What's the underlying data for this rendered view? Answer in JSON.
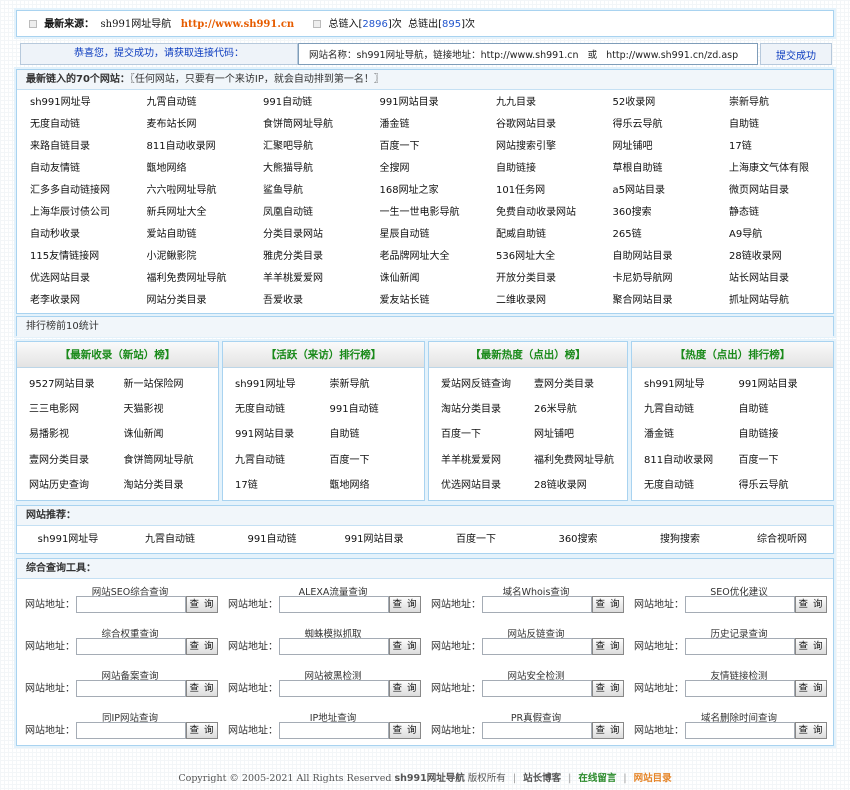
{
  "top_bar": {
    "label": "最新来源：",
    "site_name": "sh991网址导航",
    "site_url": "http://www.sh991.cn",
    "links_in_label": "总链入[",
    "links_in": "2896",
    "links_in_suffix": "]次",
    "links_out_label": "总链出[",
    "links_out": "895",
    "links_out_suffix": "]次"
  },
  "submit": {
    "congrats": "恭喜您，提交成功，请获取连接代码：",
    "code_value": "网站名称：sh991网址导航，链接地址：http://www.sh991.cn   或   http://www.sh991.cn/zd.asp",
    "button": "提交成功"
  },
  "newest": {
    "title_bold": "最新链入的70个网站：",
    "title_rest": "〖任何网站，只要有一个来访IP，就会自动排到第一名！〗",
    "sites": [
      "sh991网址导",
      "九霄自动链",
      "991自动链",
      "991网站目录",
      "九九目录",
      "52收录网",
      "崇新导航",
      "无度自动链",
      "麦布站长网",
      "食饼筒网址导航",
      "潘金链",
      "谷歌网站目录",
      "得乐云导航",
      "自助链",
      "来路自链目录",
      "811自动收录网",
      "汇聚吧导航",
      "百度一下",
      "网站搜索引擎",
      "网址铺吧",
      "17链",
      "自动友情链",
      "甑地网络",
      "大熊猫导航",
      "全搜网",
      "自助链接",
      "草根自助链",
      "上海康文气体有限",
      "汇多多自动链接网",
      "六六啦网址导航",
      "鲨鱼导航",
      "168网址之家",
      "101任务网",
      "a5网站目录",
      "微页网站目录",
      "上海华辰讨债公司",
      "新兵网址大全",
      "凤凰自动链",
      "一生一世电影导航",
      "免费自动收录网站",
      "360搜索",
      "静态链",
      "自动秒收录",
      "爱站自助链",
      "分类目录网站",
      "星辰自动链",
      "配威自助链",
      "265链",
      "A9导航",
      "115友情链接网",
      "小泥鳅影院",
      "雅虎分类目录",
      "老品牌网址大全",
      "536网址大全",
      "自助网站目录",
      "28链收录网",
      "优选网站目录",
      "福利免费网址导航",
      "羊羊桃爱爱网",
      "诛仙新闻",
      "开放分类目录",
      "卡尼奶导航网",
      "站长网站目录",
      "老李收录网",
      "网站分类目录",
      "吾爱收录",
      "爱友站长链",
      "二维收录网",
      "聚合网站目录",
      "抓址网站导航"
    ]
  },
  "rank_heading": "排行榜前10统计",
  "ranks": [
    {
      "title": "【最新收录（新站）榜】",
      "items": [
        "9527网站目录",
        "新一站保险网",
        "三三电影网",
        "天猫影视",
        "易播影视",
        "诛仙新闻",
        "壹网分类目录",
        "食饼筒网址导航",
        "网站历史查询",
        "淘站分类目录"
      ]
    },
    {
      "title": "【活跃（来访）排行榜】",
      "items": [
        "sh991网址导",
        "崇新导航",
        "无度自动链",
        "991自动链",
        "991网站目录",
        "自助链",
        "九霄自动链",
        "百度一下",
        "17链",
        "甑地网络"
      ]
    },
    {
      "title": "【最新热度（点出）榜】",
      "items": [
        "爱站网反链查询",
        "壹网分类目录",
        "淘站分类目录",
        "26米导航",
        "百度一下",
        "网址铺吧",
        "羊羊桃爱爱网",
        "福利免费网址导航",
        "优选网站目录",
        "28链收录网"
      ]
    },
    {
      "title": "【热度（点出）排行榜】",
      "items": [
        "sh991网址导",
        "991网站目录",
        "九霄自动链",
        "自助链",
        "潘金链",
        "自助链接",
        "811自动收录网",
        "百度一下",
        "无度自动链",
        "得乐云导航"
      ]
    }
  ],
  "recommend": {
    "title": "网站推荐：",
    "items": [
      "sh991网址导",
      "九霄自动链",
      "991自动链",
      "991网站目录",
      "百度一下",
      "360搜索",
      "搜狗搜索",
      "综合视听网"
    ]
  },
  "tools": {
    "title": "综合查询工具：",
    "address_label": "网站地址：",
    "button_label": "查 询",
    "items": [
      "网站SEO综合查询",
      "ALEXA流量查询",
      "域名Whois查询",
      "SEO优化建议",
      "综合权重查询",
      "蜘蛛模拟抓取",
      "网站反链查询",
      "历史记录查询",
      "网站备案查询",
      "网站被黑检测",
      "网站安全检测",
      "友情链接检测",
      "同IP网站查询",
      "IP地址查询",
      "PR真假查询",
      "域名删除时间查询"
    ]
  },
  "footer": {
    "copyright": "Copyright © 2005-2021 All Rights Reserved",
    "site": "sh991网址导航",
    "rights": "版权所有",
    "blog": "站长博客",
    "message": "在线留言",
    "directory": "网站目录"
  },
  "colors": {
    "accent_orange": "#e65c00",
    "link_blue": "#2255cc",
    "rank_green": "#1a8a1a",
    "border_blue": "#a9d3f0"
  }
}
